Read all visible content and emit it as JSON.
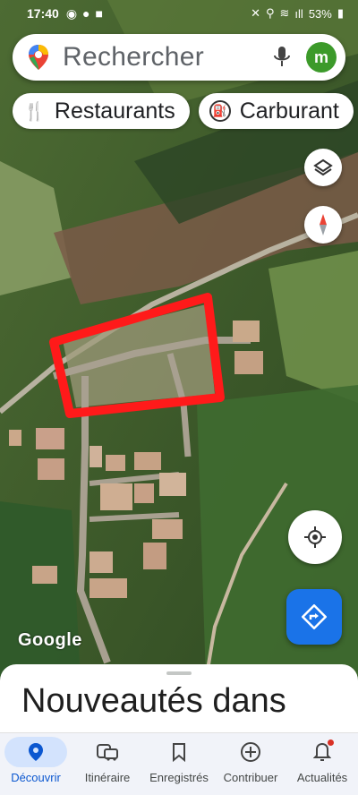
{
  "status_bar": {
    "time": "17:40",
    "battery": "53%"
  },
  "search": {
    "placeholder": "Rechercher",
    "avatar_initial": "m"
  },
  "chips": [
    {
      "label": "Restaurants",
      "icon": "restaurant-icon"
    },
    {
      "label": "Carburant",
      "icon": "fuel-icon"
    }
  ],
  "map": {
    "logo": "Google",
    "highlight_color": "#ff1a1a"
  },
  "sheet": {
    "title": "Nouveautés dans"
  },
  "nav": [
    {
      "label": "Découvrir",
      "icon": "explore-pin-icon",
      "active": true
    },
    {
      "label": "Itinéraire",
      "icon": "commute-icon",
      "active": false
    },
    {
      "label": "Enregistrés",
      "icon": "bookmark-icon",
      "active": false
    },
    {
      "label": "Contribuer",
      "icon": "add-circle-icon",
      "active": false
    },
    {
      "label": "Actualités",
      "icon": "bell-icon",
      "active": false
    }
  ],
  "colors": {
    "accent": "#1a73e8",
    "avatar_bg": "#3c9a2a"
  }
}
